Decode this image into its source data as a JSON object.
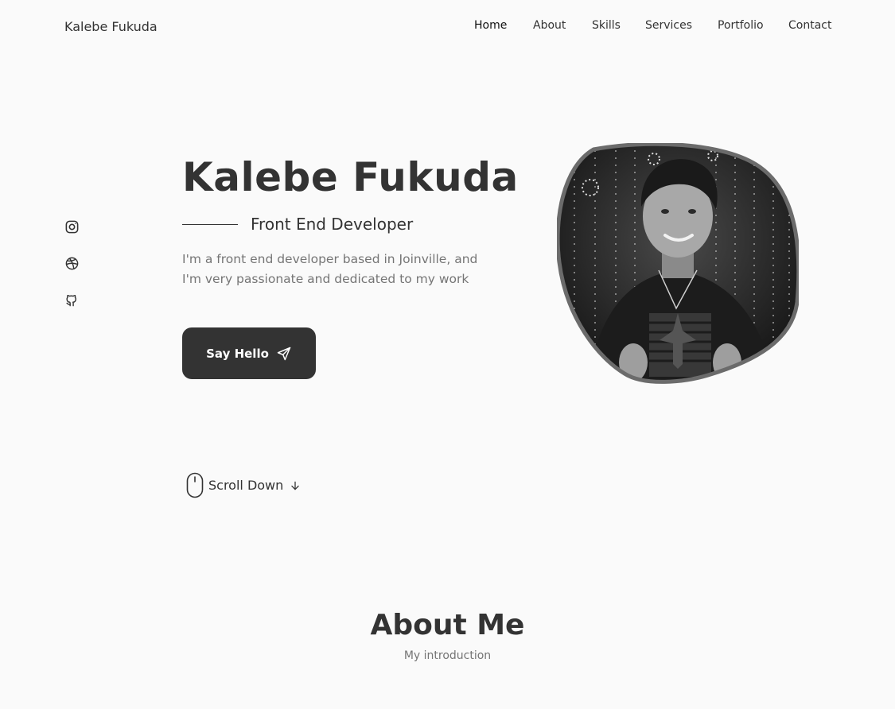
{
  "header": {
    "logo": "Kalebe Fukuda",
    "nav": [
      "Home",
      "About",
      "Skills",
      "Services",
      "Portfolio",
      "Contact"
    ],
    "active_nav": "Home"
  },
  "social": [
    "instagram-icon",
    "dribbble-icon",
    "github-icon"
  ],
  "hero": {
    "title": "Kalebe Fukuda",
    "subtitle": "Front End Developer",
    "description": "I'm a front end developer based in Joinville, and I'm very passionate and dedicated to my work",
    "button_label": "Say Hello",
    "button_icon": "send-icon",
    "photo_alt": "profile-photo"
  },
  "scroll": {
    "label": "Scroll Down",
    "mouse_icon": "mouse-icon",
    "arrow_icon": "arrow-down-icon"
  },
  "about": {
    "title": "About Me",
    "subtitle": "My introduction"
  },
  "colors": {
    "background": "#fafafa",
    "text": "#333333",
    "muted": "#757575",
    "button": "#333333"
  }
}
